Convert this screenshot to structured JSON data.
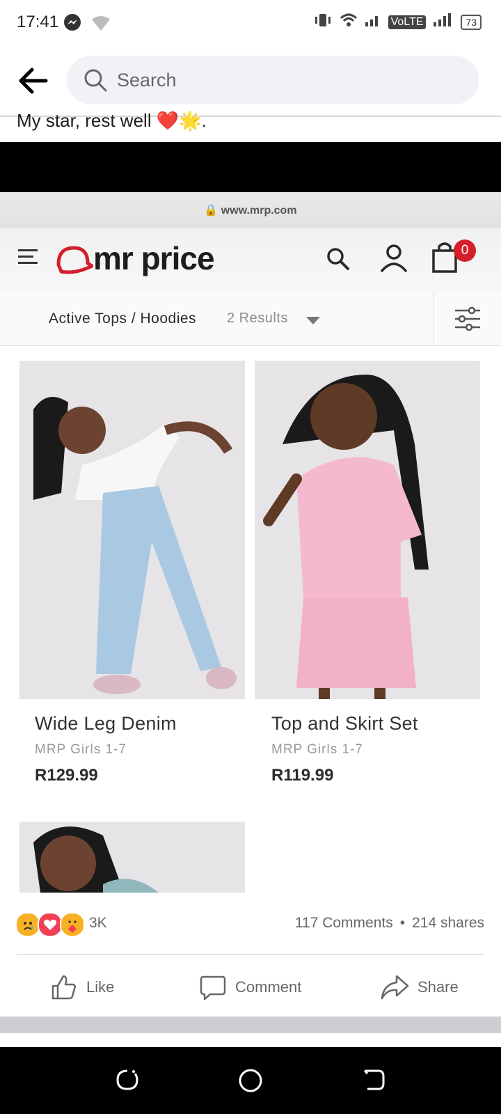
{
  "status_bar": {
    "time": "17:41",
    "volte": "VoLTE",
    "battery": "73",
    "icons": [
      "messenger-icon",
      "wifi-off-icon",
      "vibrate-icon",
      "wifi-icon",
      "signal-icon"
    ]
  },
  "header": {
    "search_placeholder": "Search"
  },
  "post": {
    "text": "My star, rest well ❤️🌟."
  },
  "photo": {
    "url": "www.mrp.com",
    "logo_text": "mr price",
    "bag_count": "0",
    "category": "Active Tops / Hoodies",
    "results": "2 Results",
    "products": [
      {
        "name": "Wide Leg Denim",
        "brand": "MRP Girls 1-7",
        "price": "R129.99"
      },
      {
        "name": "Top and Skirt Set",
        "brand": "MRP Girls 1-7",
        "price": "R119.99"
      }
    ],
    "colors": {
      "brand_red": "#d3202b"
    }
  },
  "engagement": {
    "reactions": [
      "sad",
      "love",
      "care"
    ],
    "reaction_count": "3K",
    "comments": "117 Comments",
    "separator": "•",
    "shares": "214 shares"
  },
  "actions": {
    "like": "Like",
    "comment": "Comment",
    "share": "Share"
  }
}
